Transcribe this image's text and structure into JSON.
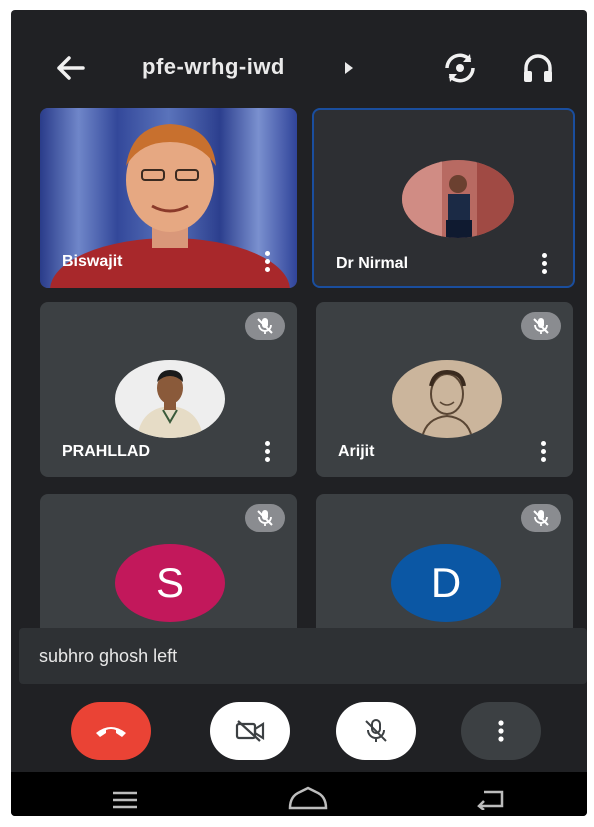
{
  "meeting": {
    "code": "pfe-wrhg-iwd"
  },
  "participants": [
    {
      "name": "Biswajit"
    },
    {
      "name": "Dr Nirmal"
    },
    {
      "name": "PRAHLLAD"
    },
    {
      "name": "Arijit"
    },
    {
      "initial": "S"
    },
    {
      "initial": "D"
    }
  ],
  "toast": {
    "message": "subhro ghosh left"
  },
  "colors": {
    "end_call": "#ea4335",
    "active_speaker_border": "#1a4e9e",
    "avatar_s": "#c2185b",
    "avatar_d": "#0b57a4"
  },
  "icons": {
    "top": [
      "back-arrow-icon",
      "switch-camera-icon",
      "headphones-icon"
    ],
    "controls": [
      "end-call-icon",
      "camera-off-icon",
      "mic-off-icon",
      "more-vertical-icon"
    ],
    "nav": [
      "menu-icon",
      "home-icon",
      "back-icon"
    ]
  }
}
